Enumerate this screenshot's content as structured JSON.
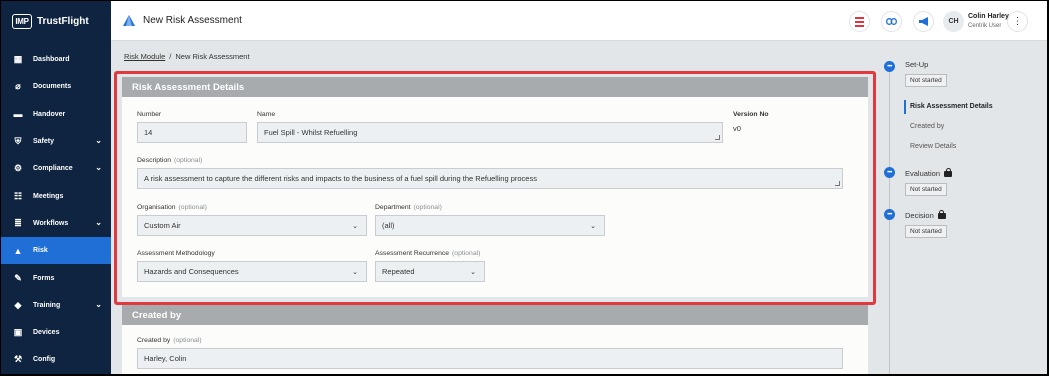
{
  "app": {
    "logo_mark": "IMP",
    "logo_text": "TrustFlight"
  },
  "header": {
    "title": "New Risk Assessment",
    "user_initials": "CH",
    "user_name": "Colin Harley",
    "user_role": "Centrik User",
    "more_icon": "⋮"
  },
  "sidebar": {
    "items": [
      {
        "label": "Dashboard",
        "icon": "▦",
        "expandable": false
      },
      {
        "label": "Documents",
        "icon": "⌀",
        "expandable": false
      },
      {
        "label": "Handover",
        "icon": "▬",
        "expandable": false
      },
      {
        "label": "Safety",
        "icon": "⛨",
        "expandable": true
      },
      {
        "label": "Compliance",
        "icon": "⚙",
        "expandable": true
      },
      {
        "label": "Meetings",
        "icon": "☷",
        "expandable": false
      },
      {
        "label": "Workflows",
        "icon": "≣",
        "expandable": true
      },
      {
        "label": "Risk",
        "icon": "▲",
        "expandable": false,
        "active": true
      },
      {
        "label": "Forms",
        "icon": "✎",
        "expandable": false
      },
      {
        "label": "Training",
        "icon": "◆",
        "expandable": true
      },
      {
        "label": "Devices",
        "icon": "▣",
        "expandable": false
      },
      {
        "label": "Config",
        "icon": "⚒",
        "expandable": false
      }
    ]
  },
  "breadcrumb": {
    "parent": "Risk Module",
    "separator": "/",
    "current": "New Risk Assessment"
  },
  "details": {
    "header": "Risk Assessment Details",
    "number_label": "Number",
    "number_value": "14",
    "name_label": "Name",
    "name_value": "Fuel Spill - Whilst Refuelling",
    "version_label": "Version No",
    "version_value": "v0",
    "description_label": "Description",
    "optional": "(optional)",
    "description_value": "A risk assessment to capture the different risks and impacts to the business of a fuel spill during the Refuelling process",
    "organisation_label": "Organisation",
    "organisation_value": "Custom Air",
    "department_label": "Department",
    "department_value": "(all)",
    "methodology_label": "Assessment Methodology",
    "methodology_value": "Hazards and Consequences",
    "recurrence_label": "Assessment Recurrence",
    "recurrence_value": "Repeated"
  },
  "created_by": {
    "header": "Created by",
    "label": "Created by",
    "optional": "(optional)",
    "value": "Harley, Colin"
  },
  "stepper": {
    "dot_glyph": "•••",
    "setup_title": "Set-Up",
    "setup_status": "Not started",
    "sub_items": [
      "Risk Assessment Details",
      "Created by",
      "Review Details"
    ],
    "evaluation_title": "Evaluation",
    "evaluation_status": "Not started",
    "decision_title": "Decision",
    "decision_status": "Not started"
  },
  "colors": {
    "sidebar_bg": "#0e2440",
    "active_nav": "#1f6fd6",
    "card_header": "#a7abae",
    "highlight": "#e03a3e"
  }
}
